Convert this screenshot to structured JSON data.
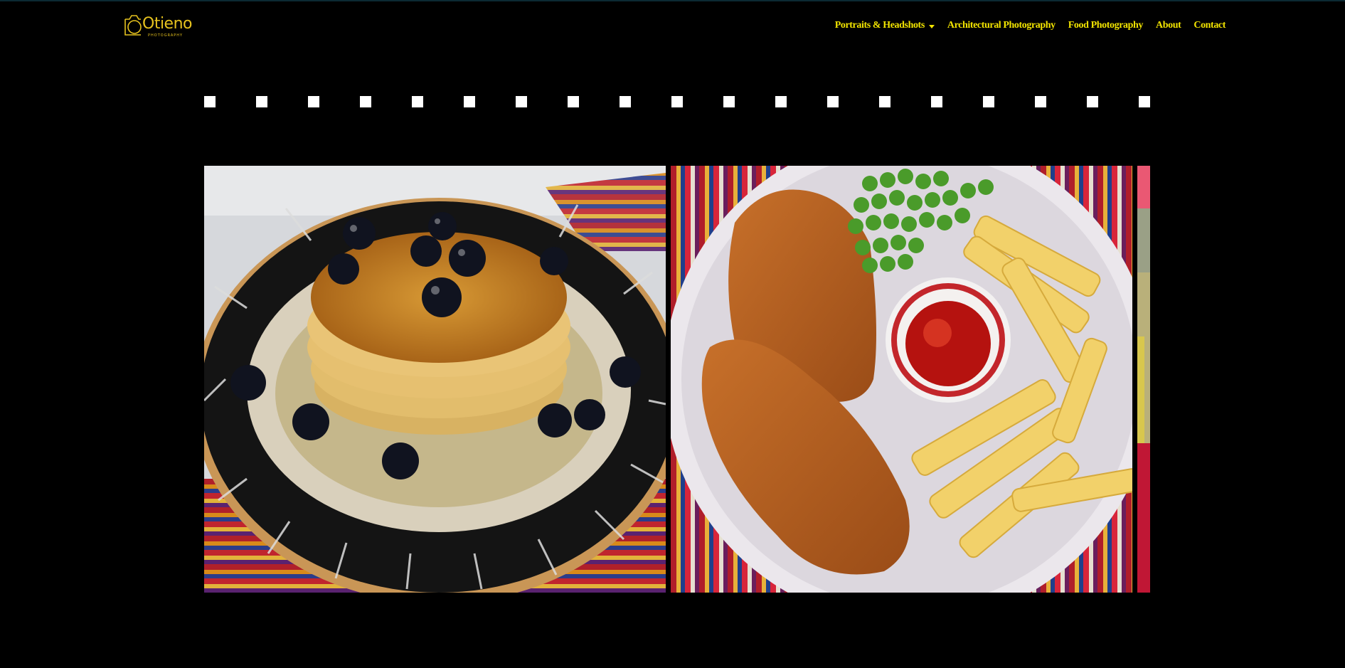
{
  "brand": {
    "name": "Otieno",
    "tagline": "PHOTOGRAPHY"
  },
  "nav": {
    "items": [
      {
        "label": "Portraits & Headshots",
        "has_dropdown": true
      },
      {
        "label": "Architectural Photography"
      },
      {
        "label": "Food Photography"
      },
      {
        "label": "About"
      },
      {
        "label": "Contact"
      }
    ]
  },
  "colors": {
    "accent": "#f2e400",
    "background": "#000000",
    "logo": "#e6c21e"
  },
  "gallery": {
    "photos": [
      {
        "subject": "pancakes-with-blueberries"
      },
      {
        "subject": "breaded-fish-fries-peas-ketchup"
      },
      {
        "subject": "partial-next-photo"
      }
    ]
  }
}
